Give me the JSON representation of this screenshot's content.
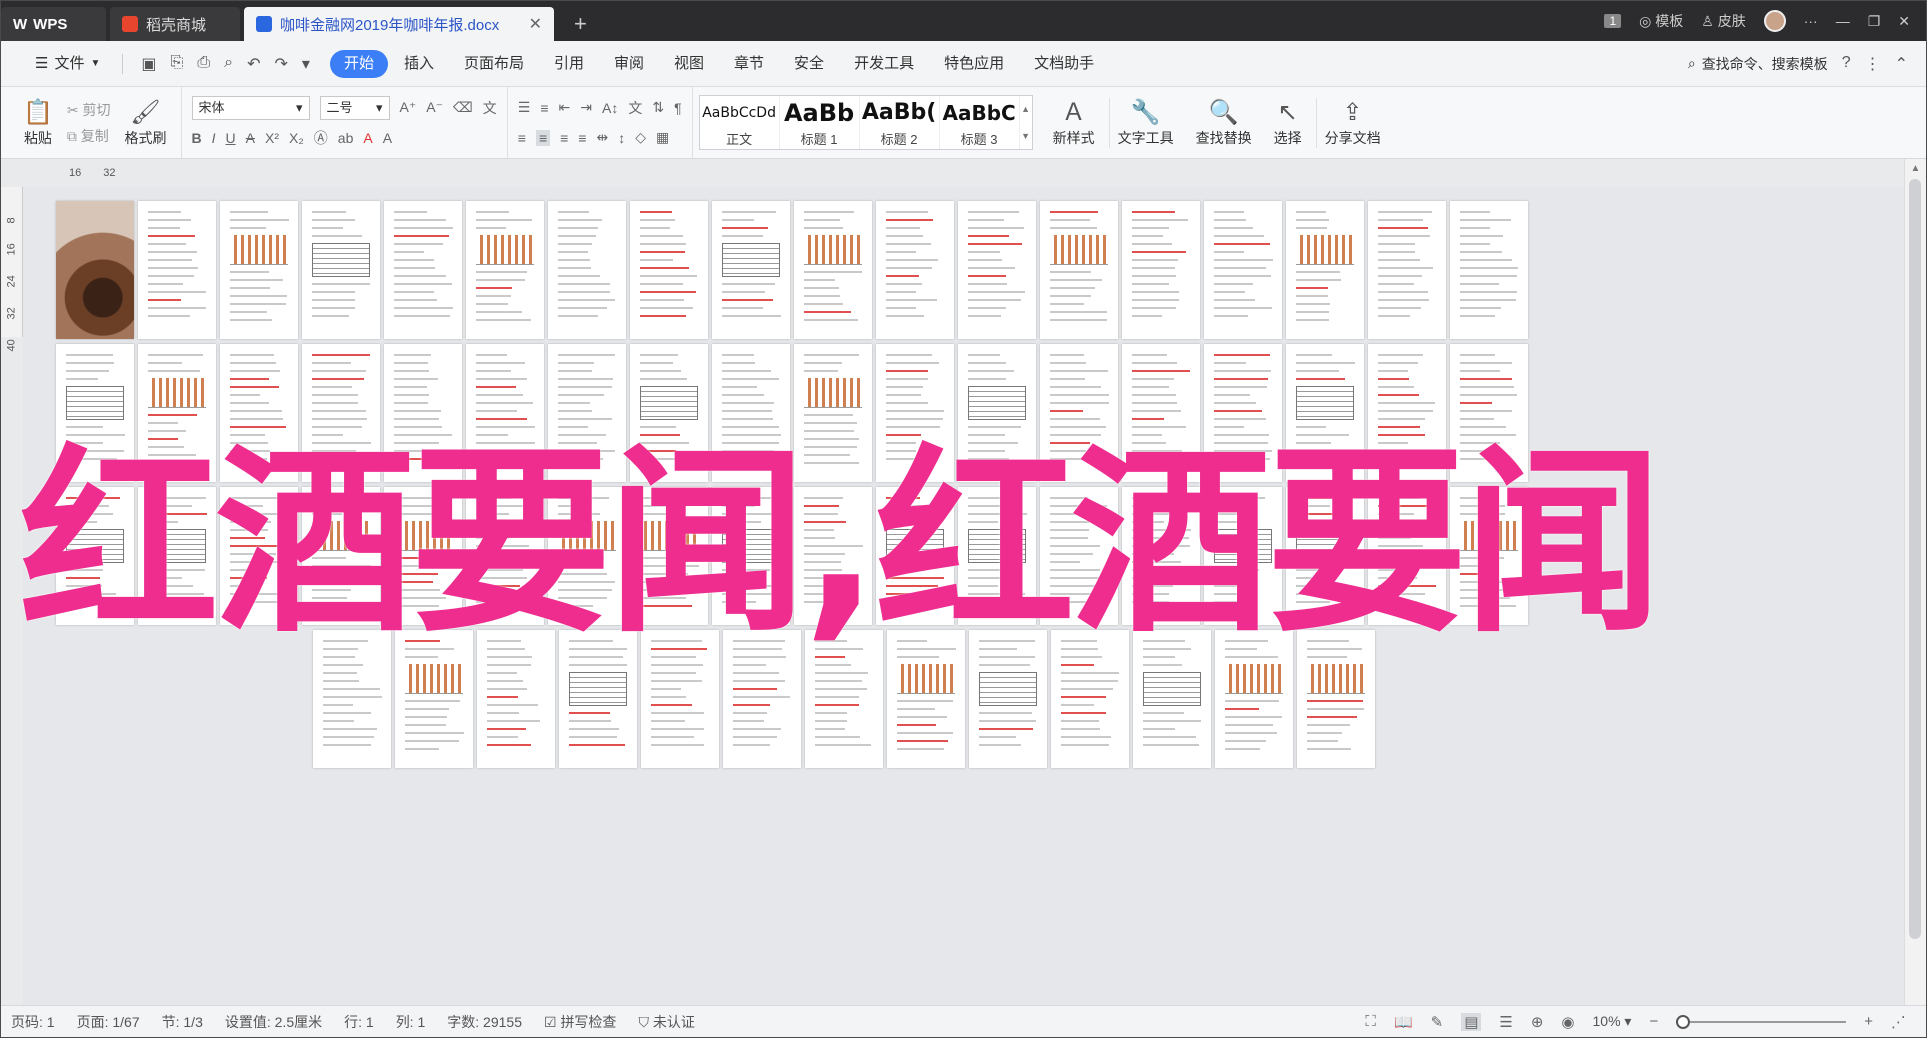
{
  "titlebar": {
    "app_tab": "WPS",
    "shop_tab": "稻壳商城",
    "doc_tab": "咖啡金融网2019年咖啡年报.docx",
    "right": {
      "badge": "1",
      "template": "模板",
      "skin": "皮肤"
    }
  },
  "menubar": {
    "file": "文件",
    "items": [
      "开始",
      "插入",
      "页面布局",
      "引用",
      "审阅",
      "视图",
      "章节",
      "安全",
      "开发工具",
      "特色应用",
      "文档助手"
    ],
    "active": "开始",
    "search": "查找命令、搜索模板"
  },
  "ribbon": {
    "paste": "粘贴",
    "cut": "剪切",
    "copy": "复制",
    "format_painter": "格式刷",
    "font": "宋体",
    "size": "二号",
    "styles": [
      {
        "preview": "AaBbCcDd",
        "name": "正文"
      },
      {
        "preview": "AaBb",
        "name": "标题 1"
      },
      {
        "preview": "AaBb(",
        "name": "标题 2"
      },
      {
        "preview": "AaBbC",
        "name": "标题 3"
      }
    ],
    "new_style": "新样式",
    "text_tools": "文字工具",
    "find_replace": "查找替换",
    "select": "选择",
    "share": "分享文档"
  },
  "ruler": {
    "h_marks": [
      "16",
      "32"
    ],
    "v_marks": [
      "8",
      "16",
      "24",
      "32",
      "40"
    ]
  },
  "overlay_text": "红酒要闻,红酒要闻",
  "status": {
    "page_code": "页码: 1",
    "page": "页面: 1/67",
    "section": "节: 1/3",
    "position": "设置值: 2.5厘米",
    "line": "行: 1",
    "column": "列: 1",
    "words": "字数: 29155",
    "spell": "拼写检查",
    "cert": "未认证",
    "zoom": "10%"
  }
}
